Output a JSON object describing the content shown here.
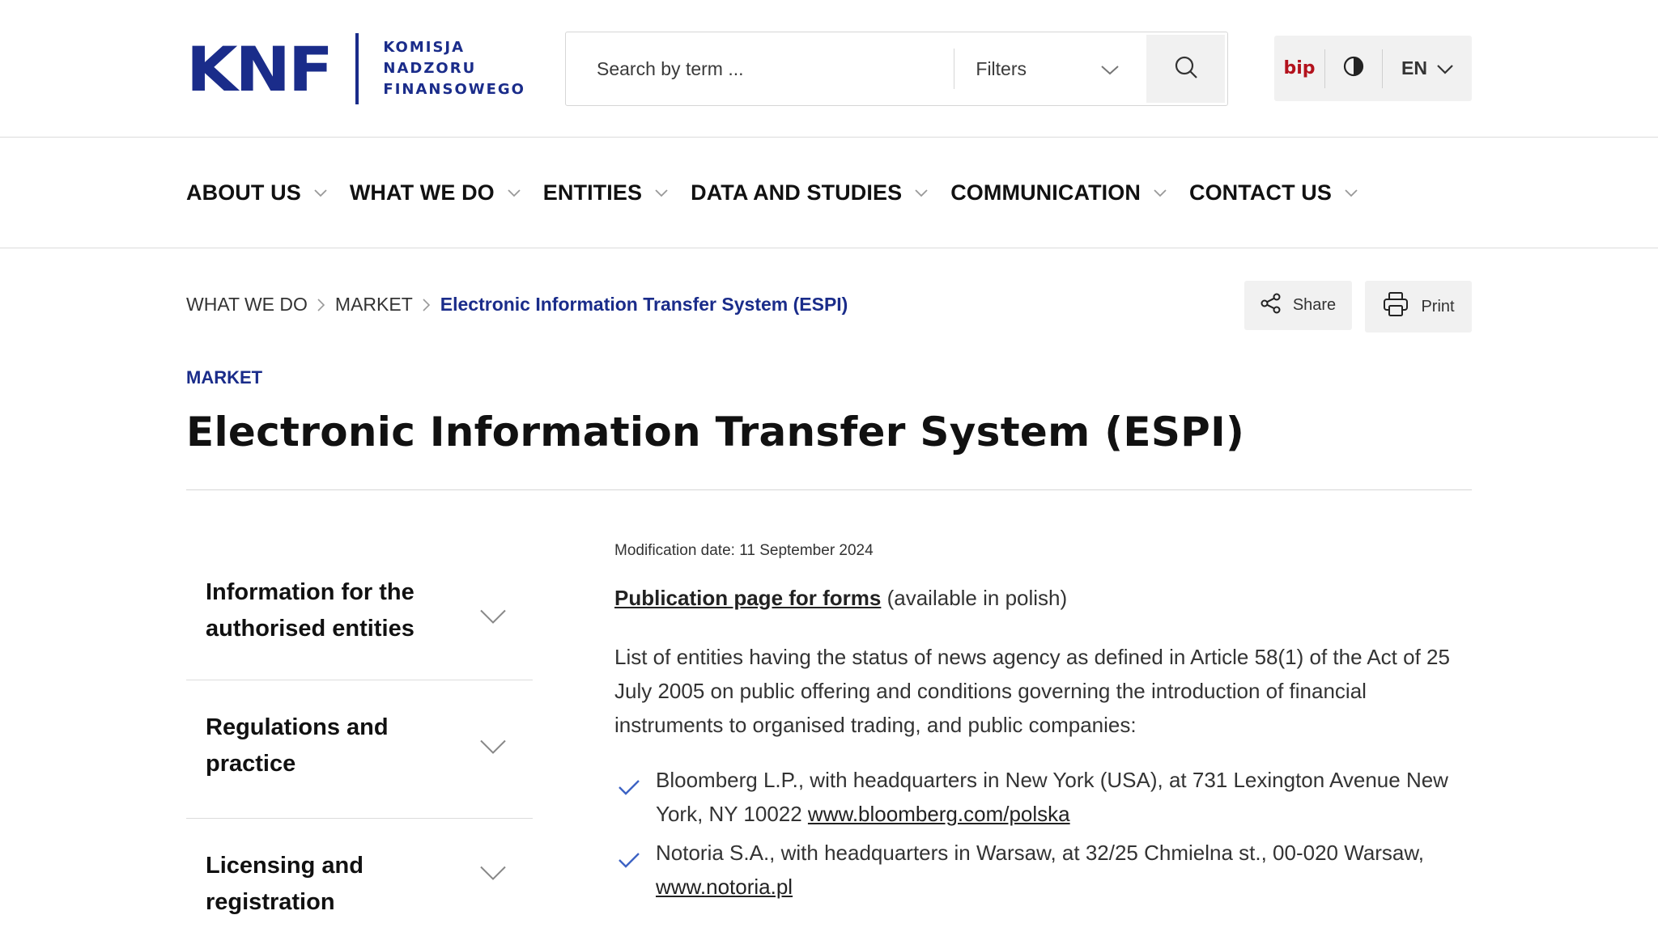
{
  "brand": {
    "logo_mark": "KNF",
    "logo_lines": [
      "KOMISJA",
      "NADZORU",
      "FINANSOWEGO"
    ],
    "primary_color": "#1a2c8a",
    "bip_color": "#b3121d"
  },
  "search": {
    "placeholder": "Search by term ...",
    "filters_label": "Filters",
    "button_icon": "search-icon"
  },
  "utility": {
    "bip_label": "bip",
    "contrast_icon": "contrast-icon",
    "language": "EN"
  },
  "nav": {
    "items": [
      {
        "label": "ABOUT US"
      },
      {
        "label": "WHAT WE DO"
      },
      {
        "label": "ENTITIES"
      },
      {
        "label": "DATA AND STUDIES"
      },
      {
        "label": "COMMUNICATION"
      },
      {
        "label": "CONTACT US"
      }
    ]
  },
  "breadcrumb": {
    "items": [
      "WHAT WE DO",
      "MARKET"
    ],
    "current": "Electronic Information Transfer System (ESPI)"
  },
  "actions": {
    "share_label": "Share",
    "print_label": "Print"
  },
  "page": {
    "category": "MARKET",
    "title": "Electronic Information Transfer System (ESPI)"
  },
  "sidebar": {
    "items": [
      {
        "label": "Information for the authorised entities"
      },
      {
        "label": "Regulations and practice"
      },
      {
        "label": "Licensing and registration"
      }
    ]
  },
  "content": {
    "modification_date": "Modification date: 11 September 2024",
    "publication_link": "Publication page for forms",
    "publication_note": " (available in polish)",
    "intro": "List of entities having the status of news agency as defined in Article 58(1) of the Act of 25 July 2005 on public offering and conditions governing the introduction of financial instruments to organised trading, and public companies:",
    "entities": [
      {
        "text": "Bloomberg L.P., with headquarters in New York (USA), at 731 Lexington Avenue New York, NY 10022 ",
        "link": "www.bloomberg.com/polska"
      },
      {
        "text": "Notoria S.A., with headquarters in Warsaw, at 32/25 Chmielna st., 00-020 Warsaw, ",
        "link": "www.notoria.pl"
      }
    ]
  }
}
